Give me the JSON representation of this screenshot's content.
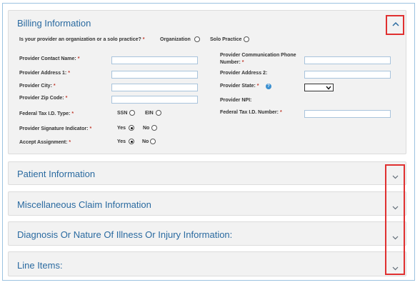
{
  "billing": {
    "title": "Billing Information",
    "question": "Is your provider an organization or a solo practice?",
    "org_label": "Organization",
    "solo_label": "Solo Practice",
    "fields": {
      "contact_name": "Provider Contact Name:",
      "address1": "Provider Address 1:",
      "city": "Provider City:",
      "zip": "Provider Zip Code:",
      "tax_type": "Federal Tax I.D. Type:",
      "signature": "Provider Signature Indicator:",
      "accept": "Accept Assignment:",
      "comm_phone": "Provider Communication Phone Number:",
      "address2": "Provider Address 2:",
      "state": "Provider State:",
      "npi": "Provider NPI:",
      "tax_number": "Federal Tax I.D. Number:"
    },
    "ssn_label": "SSN",
    "ein_label": "EIN",
    "yes_label": "Yes",
    "no_label": "No",
    "required_mark": "*",
    "help_glyph": "?",
    "collapse_icon": "chevron-up-icon"
  },
  "sections": [
    {
      "title": "Patient Information"
    },
    {
      "title": "Miscellaneous Claim Information"
    },
    {
      "title": "Diagnosis Or Nature Of Illness Or Injury Information:"
    },
    {
      "title": "Line Items:"
    }
  ],
  "highlight_color": "#e03030"
}
